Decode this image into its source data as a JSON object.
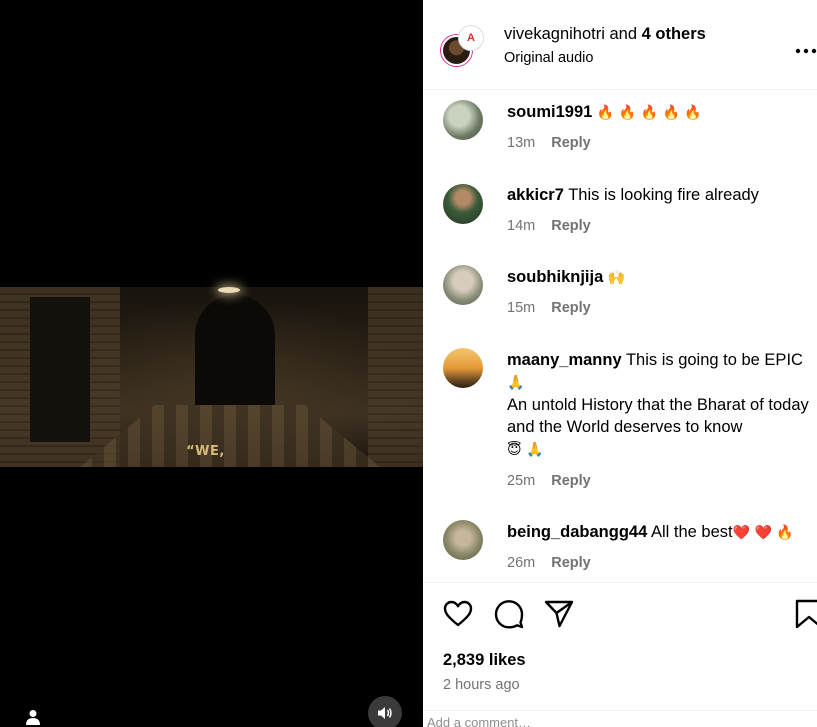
{
  "video": {
    "subtitle": "“WE,"
  },
  "header": {
    "username": "vivekagnihotri",
    "joiner": "and",
    "others": "4 others",
    "audio": "Original audio",
    "more_icon": "more-horizontal-icon"
  },
  "comments": [
    {
      "user": "soumi1991",
      "text": "",
      "emoji": "🔥 🔥 🔥 🔥 🔥",
      "time": "13m",
      "reply": "Reply"
    },
    {
      "user": "akkicr7",
      "text": "This is looking fire already",
      "emoji": "",
      "time": "14m",
      "reply": "Reply"
    },
    {
      "user": "soubhiknjija",
      "text": "",
      "emoji": "🙌",
      "time": "15m",
      "reply": "Reply"
    },
    {
      "user": "maany_manny",
      "text": "This is going to be EPIC",
      "emoji": "🙏",
      "text2": "An untold History that the Bharat of today and the World deserves to know",
      "emoji2": "😇 🙏",
      "time": "25m",
      "reply": "Reply"
    },
    {
      "user": "being_dabangg44",
      "text": "All the best",
      "emoji": "❤️ ❤️ 🔥",
      "time": "26m",
      "reply": "Reply"
    }
  ],
  "actions": {
    "like_icon": "heart-icon",
    "comment_icon": "comment-icon",
    "share_icon": "send-icon",
    "save_icon": "bookmark-icon"
  },
  "likes": "2,839 likes",
  "posted": "2 hours ago",
  "bottom_partial": "Add a comment…"
}
